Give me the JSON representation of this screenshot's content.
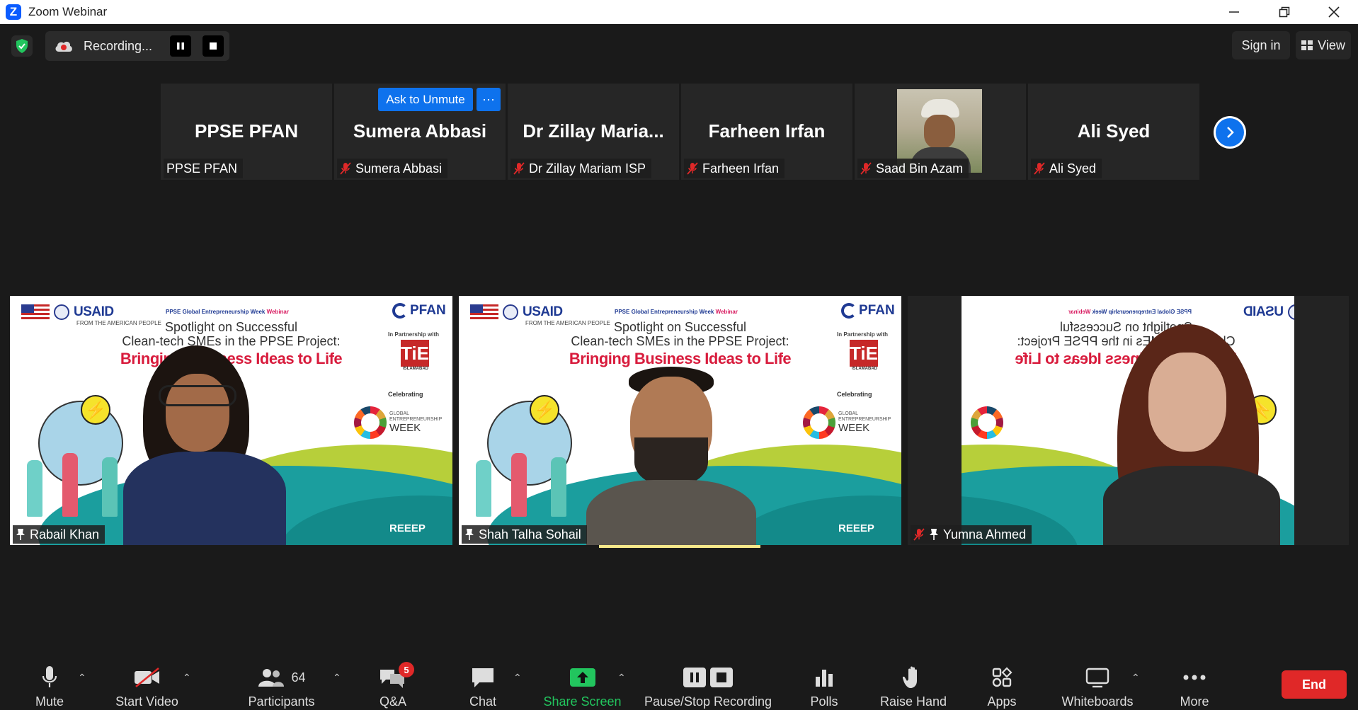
{
  "window": {
    "title": "Zoom Webinar"
  },
  "topbar": {
    "recording_label": "Recording...",
    "sign_in_label": "Sign in",
    "view_label": "View"
  },
  "unmute": {
    "label": "Ask to Unmute",
    "more": "···"
  },
  "participants": [
    {
      "display": "PPSE PFAN",
      "label": "PPSE PFAN",
      "muted": false
    },
    {
      "display": "Sumera Abbasi",
      "label": "Sumera Abbasi",
      "muted": true
    },
    {
      "display": "Dr Zillay Maria...",
      "label": "Dr Zillay Mariam ISP",
      "muted": true
    },
    {
      "display": "Farheen Irfan",
      "label": "Farheen Irfan",
      "muted": true
    },
    {
      "display": "",
      "label": "Saad Bin Azam",
      "muted": true,
      "photo": true
    },
    {
      "display": "Ali Syed",
      "label": "Ali Syed",
      "muted": true
    }
  ],
  "slide": {
    "usaid": "USAID",
    "usaid_sub": "FROM THE AMERICAN PEOPLE",
    "pfan": "PFAN",
    "header_prefix": "PPSE Global Entrepreneurship Week",
    "header_suffix": "Webinar",
    "line1": "Spotlight on Successful",
    "line2": "Clean-tech SMEs in the PPSE Project:",
    "line3": "Bringing Business Ideas to Life",
    "partnership": "In Partnership with",
    "tie": "TiE",
    "tie_sub": "ISLAMABAD",
    "celebrating": "Celebrating",
    "gew_small1": "GLOBAL",
    "gew_small2": "ENTREPRENEURSHIP",
    "gew_big": "WEEK",
    "reeep": "REEEP"
  },
  "videos": [
    {
      "name": "Rabail Khan"
    },
    {
      "name": "Shah Talha Sohail"
    },
    {
      "name": "Yumna Ahmed"
    }
  ],
  "toolbar": {
    "mute": "Mute",
    "start_video": "Start Video",
    "participants": "Participants",
    "participants_count": "64",
    "qa": "Q&A",
    "qa_badge": "5",
    "chat": "Chat",
    "share_screen": "Share Screen",
    "pause_stop": "Pause/Stop Recording",
    "polls": "Polls",
    "raise_hand": "Raise Hand",
    "apps": "Apps",
    "whiteboards": "Whiteboards",
    "more": "More",
    "end": "End"
  },
  "colors": {
    "accent": "#0e72ed",
    "share": "#22c55e",
    "danger": "#e02828",
    "background": "#1a1a1a"
  }
}
